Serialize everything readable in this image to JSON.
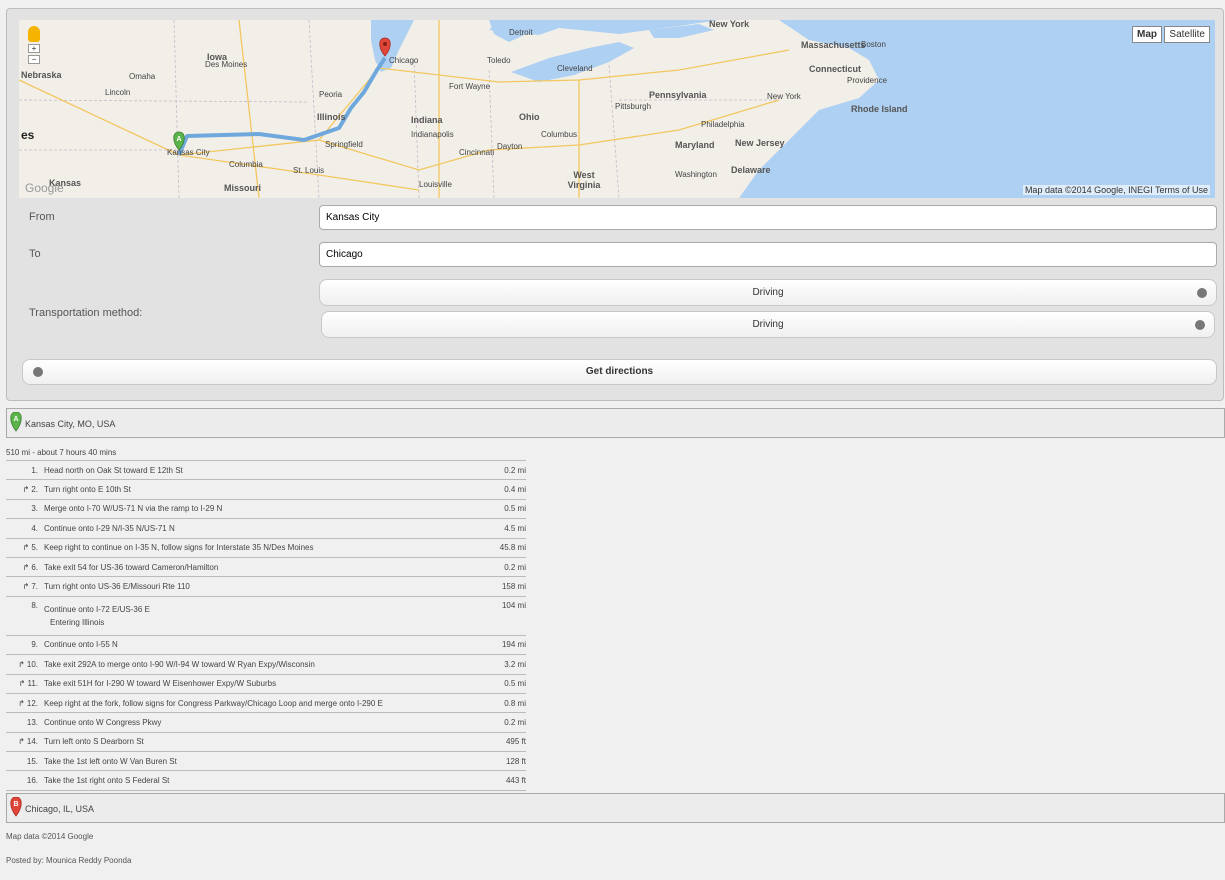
{
  "map": {
    "type_buttons": [
      "Map",
      "Satellite"
    ],
    "attribution": "Map data ©2014 Google, INEGI   Terms of Use",
    "logo": "Google",
    "labels": {
      "big": [
        {
          "text": "es"
        }
      ],
      "state": [
        {
          "text": "Iowa"
        },
        {
          "text": "Nebraska"
        },
        {
          "text": "Illinois"
        },
        {
          "text": "Indiana"
        },
        {
          "text": "Ohio"
        },
        {
          "text": "Pennsylvania"
        },
        {
          "text": "Kansas"
        },
        {
          "text": "Missouri"
        },
        {
          "text": "West Virginia"
        },
        {
          "text": "Maryland"
        },
        {
          "text": "New Jersey"
        },
        {
          "text": "Delaware"
        },
        {
          "text": "Massachusetts"
        },
        {
          "text": "Connecticut"
        },
        {
          "text": "Rhode Island"
        },
        {
          "text": "New York"
        }
      ],
      "city": [
        {
          "text": "Chicago"
        },
        {
          "text": "Kansas City"
        },
        {
          "text": "Omaha"
        },
        {
          "text": "Lincoln"
        },
        {
          "text": "Des Moines"
        },
        {
          "text": "Detroit"
        },
        {
          "text": "Toledo"
        },
        {
          "text": "Cleveland"
        },
        {
          "text": "Columbus"
        },
        {
          "text": "Indianapolis"
        },
        {
          "text": "Cincinnati"
        },
        {
          "text": "Pittsburgh"
        },
        {
          "text": "Louisville"
        },
        {
          "text": "St. Louis"
        },
        {
          "text": "Springfield"
        },
        {
          "text": "Columbia"
        },
        {
          "text": "Philadelphia"
        },
        {
          "text": "New York"
        },
        {
          "text": "Boston"
        },
        {
          "text": "Providence"
        },
        {
          "text": "Washington"
        },
        {
          "text": "Peoria"
        },
        {
          "text": "Dayton"
        },
        {
          "text": "Fort Wayne"
        }
      ]
    },
    "colors": {
      "water": "#aed0f2",
      "land": "#f2efe9",
      "route": "#6fa8dc",
      "start_marker": "#5ab34b",
      "end_marker": "#e0453a"
    }
  },
  "form": {
    "from_label": "From",
    "from_value": "Kansas City",
    "to_label": "To",
    "to_value": "Chicago",
    "transport_label": "Transportation method:",
    "transport_value": "Driving",
    "transport_value_2": "Driving",
    "submit_label": "Get directions"
  },
  "directions": {
    "start_marker": "A",
    "start_address": "Kansas City, MO, USA",
    "summary": "510 mi - about 7 hours 40 mins",
    "steps": [
      {
        "num": "1.",
        "text": "Head north on Oak St toward E 12th St",
        "dist": "0.2 mi",
        "icon": false
      },
      {
        "num": "2.",
        "text": "Turn right onto E 10th St",
        "dist": "0.4 mi",
        "icon": true
      },
      {
        "num": "3.",
        "text": "Merge onto I-70 W/US-71 N via the ramp to I-29 N",
        "dist": "0.5 mi",
        "icon": false
      },
      {
        "num": "4.",
        "text": "Continue onto I-29 N/I-35 N/US-71 N",
        "dist": "4.5 mi",
        "icon": false
      },
      {
        "num": "5.",
        "text": "Keep right to continue on I-35 N, follow signs for Interstate 35 N/Des Moines",
        "dist": "45.8 mi",
        "icon": true
      },
      {
        "num": "6.",
        "text": "Take exit 54 for US-36 toward Cameron/Hamilton",
        "dist": "0.2 mi",
        "icon": true
      },
      {
        "num": "7.",
        "text": "Turn right onto US-36 E/Missouri Rte 110",
        "dist": "158 mi",
        "icon": true
      },
      {
        "num": "8.",
        "text": "Continue onto I-72 E/US-36 E",
        "subtext": "Entering Illinois",
        "dist": "104 mi",
        "icon": false
      },
      {
        "num": "9.",
        "text": "Continue onto I-55 N",
        "dist": "194 mi",
        "icon": false
      },
      {
        "num": "10.",
        "text": "Take exit 292A to merge onto I-90 W/I-94 W toward W Ryan Expy/Wisconsin",
        "dist": "3.2 mi",
        "icon": true
      },
      {
        "num": "11.",
        "text": "Take exit 51H for I-290 W toward W Eisenhower Expy/W Suburbs",
        "dist": "0.5 mi",
        "icon": true
      },
      {
        "num": "12.",
        "text": "Keep right at the fork, follow signs for Congress Parkway/Chicago Loop and merge onto I-290 E",
        "dist": "0.8 mi",
        "icon": true
      },
      {
        "num": "13.",
        "text": "Continue onto W Congress Pkwy",
        "dist": "0.2 mi",
        "icon": false
      },
      {
        "num": "14.",
        "text": "Turn left onto S Dearborn St",
        "dist": "495 ft",
        "icon": true
      },
      {
        "num": "15.",
        "text": "Take the 1st left onto W Van Buren St",
        "dist": "128 ft",
        "icon": false
      },
      {
        "num": "16.",
        "text": "Take the 1st right onto S Federal St",
        "dist": "443 ft",
        "icon": false
      }
    ],
    "end_marker": "B",
    "end_address": "Chicago, IL, USA",
    "map_data": "Map data ©2014 Google"
  },
  "footer": {
    "posted_by": "Posted by:  Mounica Reddy Poonda"
  }
}
